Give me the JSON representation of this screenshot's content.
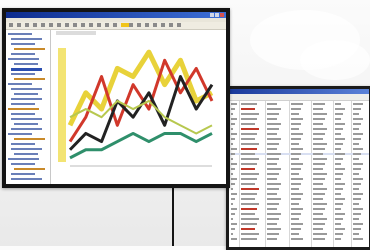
{
  "screen": {
    "description_note": "",
    "front_window": {
      "has_titlebar_controls": 3,
      "sidebar_rows": 30
    },
    "chart_data": {
      "type": "line",
      "x": [
        1,
        2,
        3,
        4,
        5,
        6,
        7,
        8,
        9,
        10
      ],
      "series": [
        {
          "values": [
            5,
            9,
            7,
            12,
            11,
            14,
            10,
            13,
            8,
            9
          ]
        },
        {
          "values": [
            3,
            6,
            11,
            5,
            10,
            7,
            13,
            9,
            12,
            8
          ]
        },
        {
          "values": [
            2,
            4,
            3,
            8,
            6,
            9,
            5,
            11,
            7,
            10
          ]
        },
        {
          "values": [
            1,
            2,
            2,
            3,
            4,
            3,
            4,
            4,
            3,
            4
          ]
        },
        {
          "values": [
            6,
            7,
            6,
            8,
            7,
            8,
            6,
            5,
            4,
            5
          ]
        }
      ],
      "colors": [
        "#e8d23a",
        "#d1382b",
        "#222222",
        "#2f8f6b",
        "#b7c84f"
      ],
      "ylim": [
        0,
        15
      ],
      "grid": false
    },
    "back_window": {
      "rows": 28,
      "highlighted_row": 10
    }
  }
}
